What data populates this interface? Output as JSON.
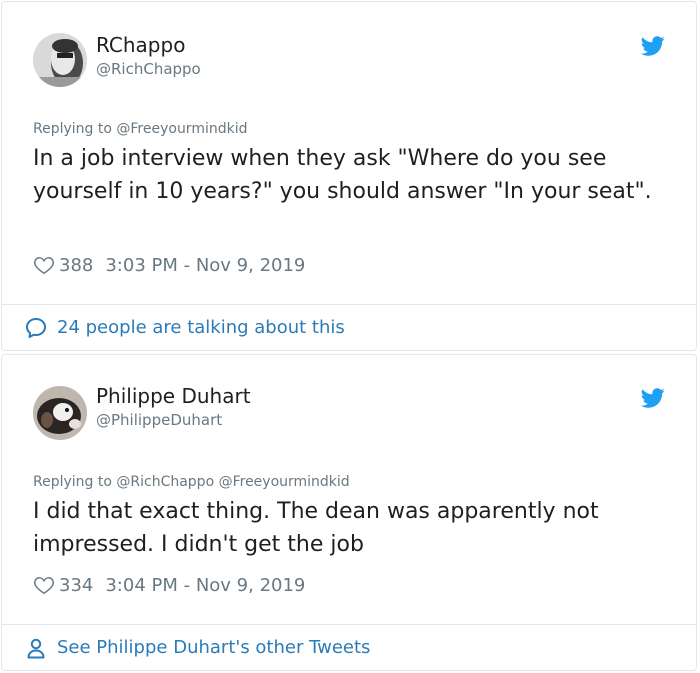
{
  "tweets": [
    {
      "author_name": "RChappo",
      "author_handle": "@RichChappo",
      "replying_to": "Replying to @Freeyourmindkid",
      "text": "In a job interview when they ask \"Where do you see yourself in 10 years?\" you should answer \"In your seat\".",
      "likes": "388",
      "timestamp": "3:03 PM - Nov 9, 2019",
      "footer_text": "24 people are talking about this",
      "footer_icon": "speech-bubble-icon"
    },
    {
      "author_name": "Philippe Duhart",
      "author_handle": "@PhilippeDuhart",
      "replying_to": "Replying to @RichChappo @Freeyourmindkid",
      "text": "I did that exact thing. The dean was apparently not impressed. I didn't get the job",
      "likes": "334",
      "timestamp": "3:04 PM - Nov 9, 2019",
      "footer_text": "See Philippe Duhart's other Tweets",
      "footer_icon": "person-icon"
    }
  ],
  "colors": {
    "twitter_blue": "#1da1f2",
    "link_blue": "#2b7bb9",
    "muted_gray": "#697882",
    "border": "#e1e8ed"
  }
}
